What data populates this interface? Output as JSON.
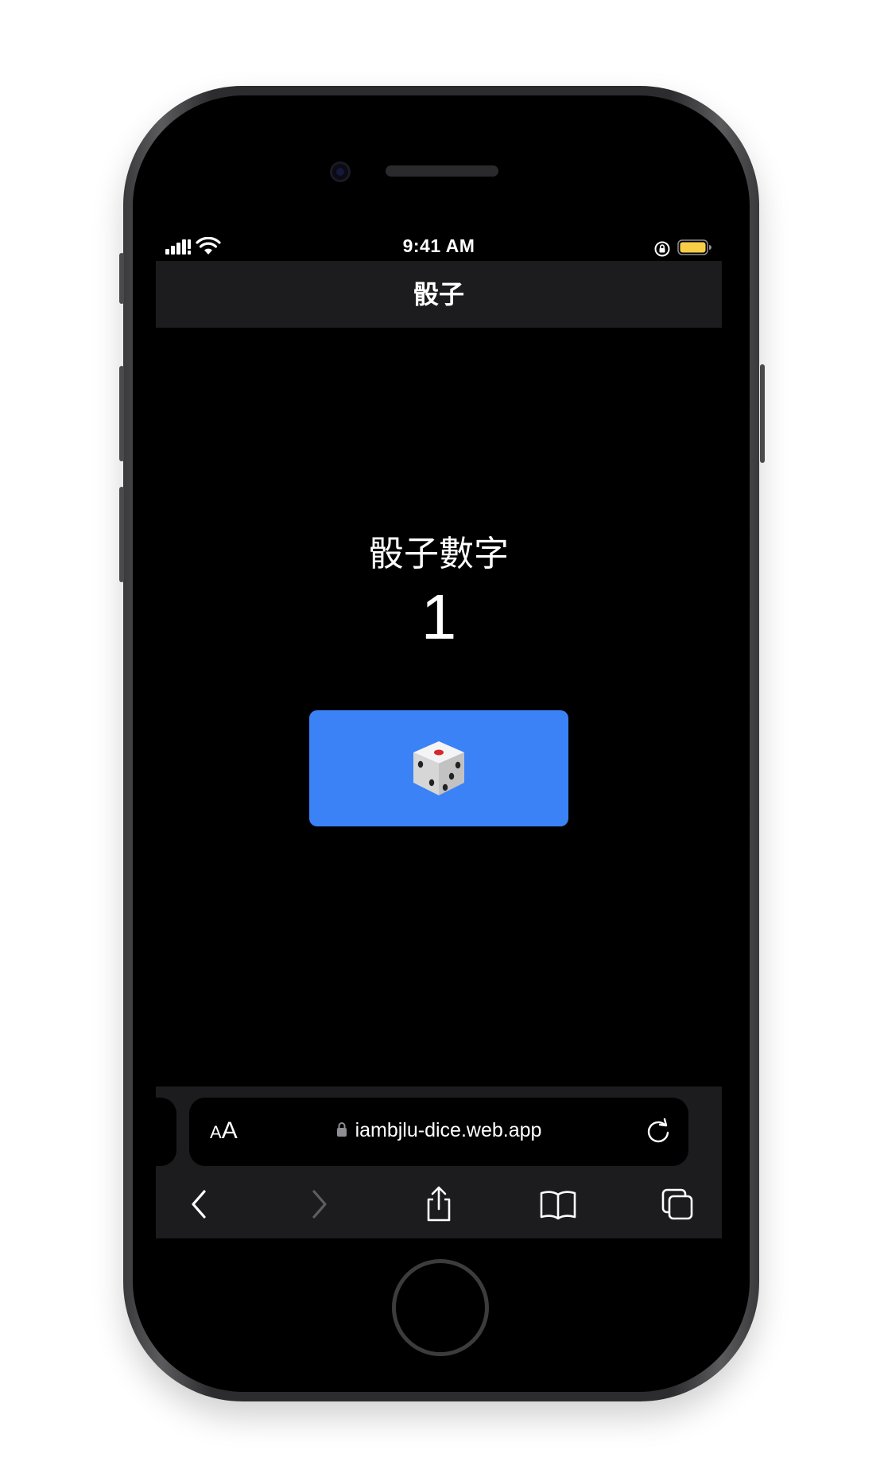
{
  "status_bar": {
    "time": "9:41 AM",
    "icons": [
      "cellular-signal-icon",
      "wifi-icon",
      "orientation-lock-icon",
      "battery-icon"
    ]
  },
  "header": {
    "title": "骰子"
  },
  "main": {
    "label": "骰子數字",
    "value": "1",
    "roll_button_icon": "dice-icon"
  },
  "browser": {
    "text_size_button": {
      "small": "A",
      "large": "A"
    },
    "url": "iambjlu-dice.web.app",
    "toolbar_icons": [
      "back-icon",
      "forward-icon",
      "share-icon",
      "bookmarks-icon",
      "tabs-icon"
    ]
  },
  "colors": {
    "accent": "#3b82f6",
    "header_bg": "#1c1c1e",
    "screen_bg": "#000000",
    "battery": "#f7ce46",
    "text": "#ffffff",
    "disabled": "#5e5e62"
  }
}
